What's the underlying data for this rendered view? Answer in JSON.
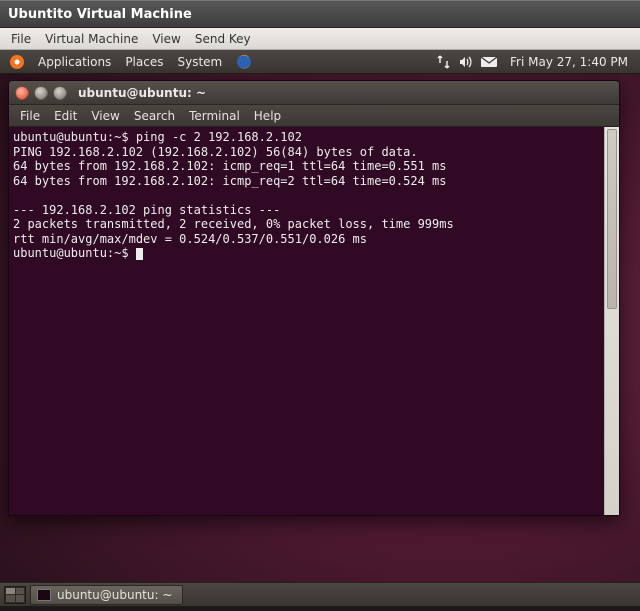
{
  "vm": {
    "title": "Ubuntito Virtual Machine",
    "menus": [
      "File",
      "Virtual Machine",
      "View",
      "Send Key"
    ]
  },
  "panel": {
    "apps": "Applications",
    "places": "Places",
    "system": "System",
    "clock": "Fri May 27,  1:40 PM"
  },
  "terminal": {
    "title": "ubuntu@ubuntu: ~",
    "menus": [
      "File",
      "Edit",
      "View",
      "Search",
      "Terminal",
      "Help"
    ],
    "lines": [
      "ubuntu@ubuntu:~$ ping -c 2 192.168.2.102",
      "PING 192.168.2.102 (192.168.2.102) 56(84) bytes of data.",
      "64 bytes from 192.168.2.102: icmp_req=1 ttl=64 time=0.551 ms",
      "64 bytes from 192.168.2.102: icmp_req=2 ttl=64 time=0.524 ms",
      "",
      "--- 192.168.2.102 ping statistics ---",
      "2 packets transmitted, 2 received, 0% packet loss, time 999ms",
      "rtt min/avg/max/mdev = 0.524/0.537/0.551/0.026 ms",
      "ubuntu@ubuntu:~$ "
    ]
  },
  "taskbar": {
    "item": "ubuntu@ubuntu: ~"
  },
  "icons": {
    "network": "network-updown-icon",
    "sound": "sound-icon",
    "mail": "mail-icon",
    "firefox": "firefox-icon"
  }
}
